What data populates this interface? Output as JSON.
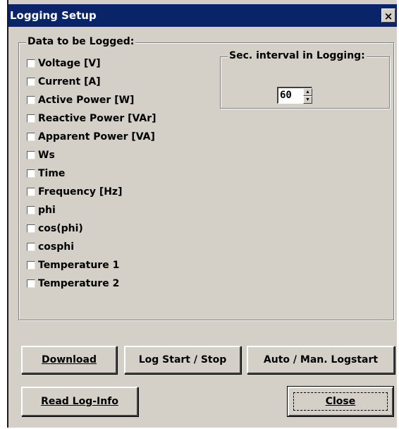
{
  "window": {
    "title": "Logging Setup",
    "close_glyph": "×"
  },
  "data_group": {
    "label": "Data to be Logged:",
    "items": [
      {
        "label": "Voltage [V]",
        "checked": false
      },
      {
        "label": "Current [A]",
        "checked": false
      },
      {
        "label": "Active Power [W]",
        "checked": false
      },
      {
        "label": "Reactive Power [VAr]",
        "checked": false
      },
      {
        "label": "Apparent Power [VA]",
        "checked": false
      },
      {
        "label": "Ws",
        "checked": false
      },
      {
        "label": "Time",
        "checked": false
      },
      {
        "label": "Frequency [Hz]",
        "checked": false
      },
      {
        "label": "phi",
        "checked": false
      },
      {
        "label": "cos(phi)",
        "checked": false
      },
      {
        "label": "cosphi",
        "checked": false
      },
      {
        "label": "Temperature 1",
        "checked": false
      },
      {
        "label": "Temperature 2",
        "checked": false
      }
    ]
  },
  "interval_group": {
    "label": "Sec. interval in Logging:",
    "value": "60"
  },
  "buttons": {
    "download": "Download",
    "log_start_stop": "Log Start / Stop",
    "auto_man_logstart": "Auto / Man. Logstart",
    "read_log_info": "Read Log-Info",
    "close": "Close"
  },
  "colors": {
    "titlebar": "#0a246a",
    "face": "#d4d0c8"
  }
}
